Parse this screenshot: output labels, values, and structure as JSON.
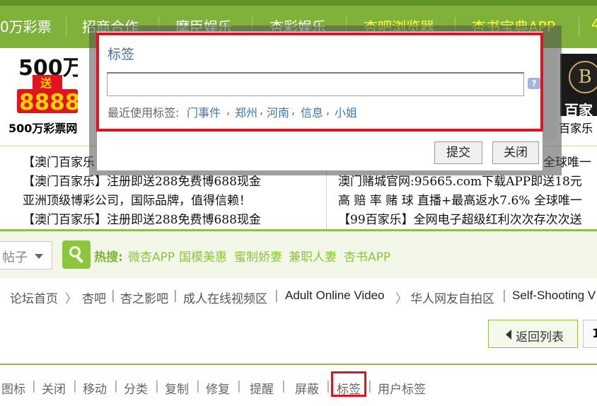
{
  "topnav": {
    "items": [
      {
        "label": "0万彩票",
        "style": "white"
      },
      {
        "label": "招商合作",
        "style": "white"
      },
      {
        "label": "摩臣娱乐",
        "style": "white"
      },
      {
        "label": "杏彩娱乐",
        "style": "white"
      },
      {
        "label": "杏吧浏览器",
        "style": "yellow"
      },
      {
        "label": "杏书宝典APP",
        "style": "yellow"
      },
      {
        "label": "4",
        "style": "yellow"
      }
    ]
  },
  "ads": {
    "left": {
      "logo_top": "500万",
      "logo_mid": "送",
      "logo_num": "8888",
      "label": "500万彩票网"
    },
    "right": {
      "logo_letter": "B",
      "logo_text": "百家",
      "label": "百家乐"
    }
  },
  "text_ads": {
    "left": [
      "【澳门百家乐",
      "【澳门百家乐】注册即送288免费博688现金",
      "亚洲顶级博彩公司，国际品牌，值得信赖！",
      "【澳门百家乐】注册即送288免费博688现金"
    ],
    "right": [
      "全球唯一",
      "澳门赌城官网:95665.com下载APP即送18元",
      "高 赔 率 赌 球 直播+最高返水7.6% 全球唯一",
      "【99百家乐】全网电子超级红利次次存次次送"
    ]
  },
  "search": {
    "select_value": "帖子",
    "hot_label": "热搜:",
    "hot_keywords": [
      "微杏APP",
      "国模美惠",
      "蜜制娇妻",
      "兼职人妻",
      "杏书APP"
    ]
  },
  "breadcrumb": {
    "items": [
      "论坛首页",
      "杏吧",
      "杏之影吧",
      "成人在线视频区",
      "Adult Online Video",
      "华人网友自拍区",
      "Self-Shooting V"
    ],
    "seps": [
      "〉",
      "|",
      "|",
      "|",
      "〉",
      "|"
    ]
  },
  "nav_buttons": {
    "back": "返回列表",
    "page": "1"
  },
  "modbar": {
    "items": [
      "图标",
      "关闭",
      "移动",
      "分类",
      "复制",
      "修复",
      "提醒",
      "屏蔽",
      "标签",
      "用户标签"
    ]
  },
  "dialog": {
    "title": "标签",
    "input_value": "",
    "help": "?",
    "recent_label": "最近使用标签:",
    "recent_tags": [
      "门事件",
      "郑州",
      "河南",
      "信息",
      "小姐"
    ],
    "submit": "提交",
    "close": "关闭"
  },
  "colors": {
    "nav_green": "#7fb13b",
    "highlight_red": "#e0141e",
    "link_blue": "#3c78b4"
  }
}
